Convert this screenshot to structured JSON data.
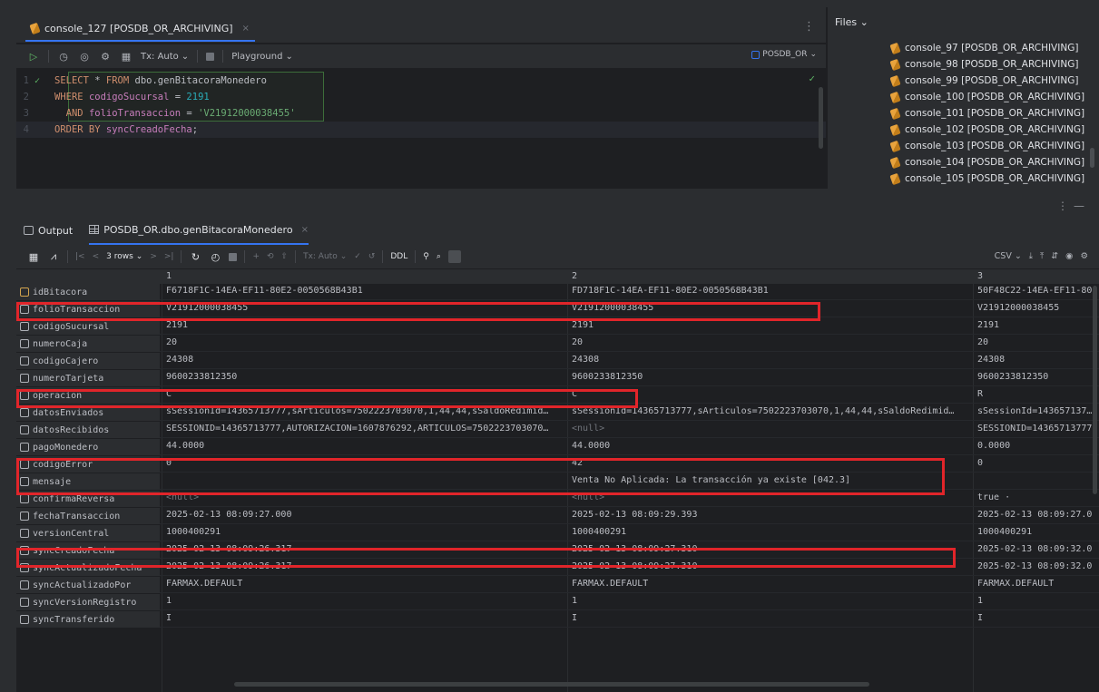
{
  "editor": {
    "tab_label": "console_127 [POSDB_OR_ARCHIVING]",
    "tab_close": "×",
    "toolbar": {
      "tx_label": "Tx: Auto",
      "playground_label": "Playground",
      "datasource_label": "POSDB_OR"
    },
    "lines": [
      {
        "num": "1",
        "kw1": "SELECT",
        "t1": " * ",
        "kw2": "FROM",
        "t2": " dbo.genBitacoraMonedero"
      },
      {
        "num": "2",
        "kw1": "WHERE",
        "t1": " ",
        "ident": "codigoSucursal",
        "t2": " = ",
        "num_val": "2191"
      },
      {
        "num": "3",
        "kw1": "  AND",
        "t1": " ",
        "ident": "folioTransaccion",
        "t2": " = ",
        "str_val": "'V21912000038455'"
      },
      {
        "num": "4",
        "kw1": "ORDER BY",
        "t1": " ",
        "ident": "syncCreadoFecha",
        "t2": ";"
      }
    ]
  },
  "files": {
    "title": "Files",
    "items": [
      "console_97 [POSDB_OR_ARCHIVING]",
      "console_98 [POSDB_OR_ARCHIVING]",
      "console_99 [POSDB_OR_ARCHIVING]",
      "console_100 [POSDB_OR_ARCHIVING]",
      "console_101 [POSDB_OR_ARCHIVING]",
      "console_102 [POSDB_OR_ARCHIVING]",
      "console_103 [POSDB_OR_ARCHIVING]",
      "console_104 [POSDB_OR_ARCHIVING]",
      "console_105 [POSDB_OR_ARCHIVING]"
    ]
  },
  "results": {
    "tabs": {
      "output": "Output",
      "table": "POSDB_OR.dbo.genBitacoraMonedero"
    },
    "toolbar": {
      "rows_label": "3 rows",
      "tx_label": "Tx: Auto",
      "ddl_label": "DDL",
      "export_label": "CSV"
    },
    "columns": [
      "1",
      "2",
      "3"
    ],
    "rows": [
      {
        "field": "idBitacora",
        "key": true,
        "v1": "F6718F1C-14EA-EF11-80E2-0050568B43B1",
        "v2": "FD718F1C-14EA-EF11-80E2-0050568B43B1",
        "v3": "50F48C22-14EA-EF11-80"
      },
      {
        "field": "folioTransaccion",
        "v1": "V21912000038455",
        "v2": "V21912000038455",
        "v3": "V21912000038455"
      },
      {
        "field": "codigoSucursal",
        "v1": "2191",
        "v2": "2191",
        "v3": "2191"
      },
      {
        "field": "numeroCaja",
        "v1": "20",
        "v2": "20",
        "v3": "20"
      },
      {
        "field": "codigoCajero",
        "v1": "24308",
        "v2": "24308",
        "v3": "24308"
      },
      {
        "field": "numeroTarjeta",
        "v1": "9600233812350",
        "v2": "9600233812350",
        "v3": "9600233812350"
      },
      {
        "field": "operacion",
        "v1": "C",
        "v2": "C",
        "v3": "R"
      },
      {
        "field": "datosEnviados",
        "v1": "sSessionId=14365713777,sArticulos=7502223703070,1,44,44,sSaldoRedimid…",
        "v2": "sSessionId=14365713777,sArticulos=7502223703070,1,44,44,sSaldoRedimid…",
        "v3": "sSessionId=14365713777"
      },
      {
        "field": "datosRecibidos",
        "v1": "SESSIONID=14365713777,AUTORIZACION=1607876292,ARTICULOS=7502223703070…",
        "v2": "<null>",
        "v3": "SESSIONID=14365713777"
      },
      {
        "field": "pagoMonedero",
        "v1": "44.0000",
        "v2": "44.0000",
        "v3": "0.0000"
      },
      {
        "field": "codigoError",
        "v1": "0",
        "v2": "42",
        "v3": "0"
      },
      {
        "field": "mensaje",
        "v1": "",
        "v2": "Venta No Aplicada: La transacción ya existe [042.3]",
        "v3": ""
      },
      {
        "field": "confirmaReversa",
        "v1": "<null>",
        "v2": "<null>",
        "v3": "true ·"
      },
      {
        "field": "fechaTransaccion",
        "v1": "2025-02-13 08:09:27.000",
        "v2": "2025-02-13 08:09:29.393",
        "v3": "2025-02-13 08:09:27.0"
      },
      {
        "field": "versionCentral",
        "v1": "1000400291",
        "v2": "1000400291",
        "v3": "1000400291"
      },
      {
        "field": "syncCreadoFecha",
        "v1": "2025-02-13 08:09:26.317",
        "v2": "2025-02-13 08:09:27.310",
        "v3": "2025-02-13 08:09:32.0"
      },
      {
        "field": "syncActualizadoFecha",
        "v1": "2025-02-13 08:09:26.317",
        "v2": "2025-02-13 08:09:27.310",
        "v3": "2025-02-13 08:09:32.0"
      },
      {
        "field": "syncActualizadoPor",
        "v1": "FARMAX.DEFAULT",
        "v2": "FARMAX.DEFAULT",
        "v3": "FARMAX.DEFAULT"
      },
      {
        "field": "syncVersionRegistro",
        "v1": "1",
        "v2": "1",
        "v3": "1"
      },
      {
        "field": "syncTransferido",
        "v1": "I",
        "v2": "I",
        "v3": "I"
      }
    ]
  },
  "colors": {
    "highlight": "#e1252a",
    "accent": "#3574f0",
    "keyword": "#cf8e6d",
    "string": "#6aab73"
  }
}
